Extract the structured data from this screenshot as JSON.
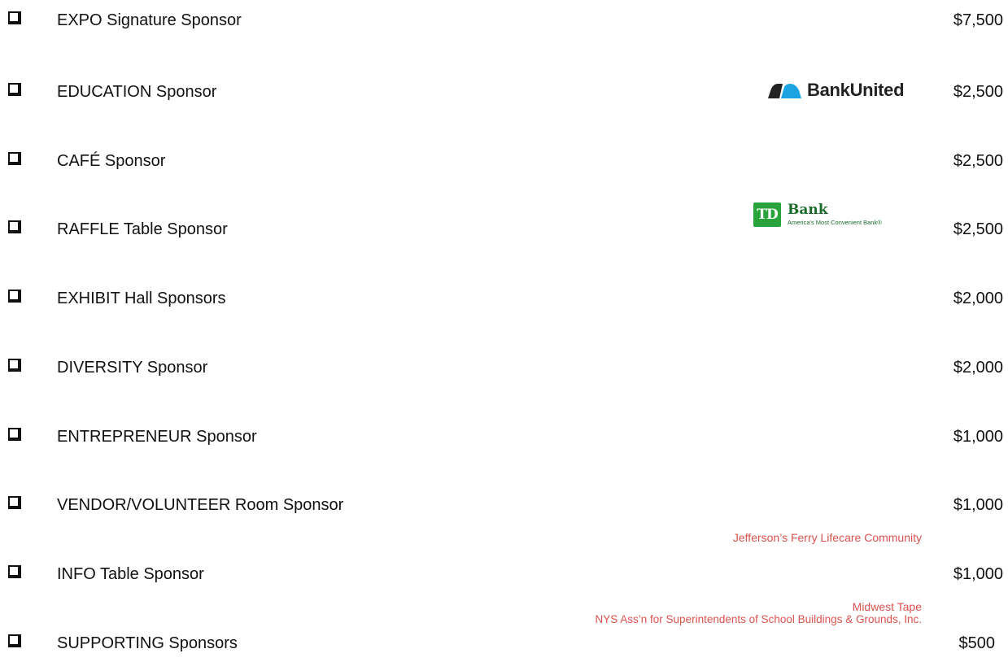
{
  "sponsorships": [
    {
      "label": "EXPO Signature Sponsor",
      "price": "$7,500"
    },
    {
      "label": "EDUCATION Sponsor",
      "price": "$2,500"
    },
    {
      "label": "CAFÉ Sponsor",
      "price": "$2,500"
    },
    {
      "label": "RAFFLE Table Sponsor",
      "price": "$2,500"
    },
    {
      "label": "EXHIBIT Hall Sponsors",
      "price": "$2,000"
    },
    {
      "label": "DIVERSITY Sponsor",
      "price": "$2,000"
    },
    {
      "label": "ENTREPRENEUR Sponsor",
      "price": "$1,000"
    },
    {
      "label": "VENDOR/VOLUNTEER Room Sponsor",
      "price": "$1,000"
    },
    {
      "label": "INFO Table Sponsor",
      "price": "$1,000"
    },
    {
      "label": "SUPPORTING Sponsors",
      "price": "$500"
    }
  ],
  "logos": {
    "bankunited": {
      "text": "BankUnited",
      "color": "#1aa3e0"
    },
    "td_bank": {
      "mark": "TD",
      "name": "Bank",
      "tagline": "America's Most Convenient Bank®",
      "color": "#2aa43a"
    }
  },
  "sponsor_names": {
    "vendor_volunteer": "Jefferson’s Ferry Lifecare Community",
    "supporting": [
      "Midwest Tape",
      "NYS Ass’n for Superintendents of School Buildings & Grounds, Inc."
    ]
  }
}
